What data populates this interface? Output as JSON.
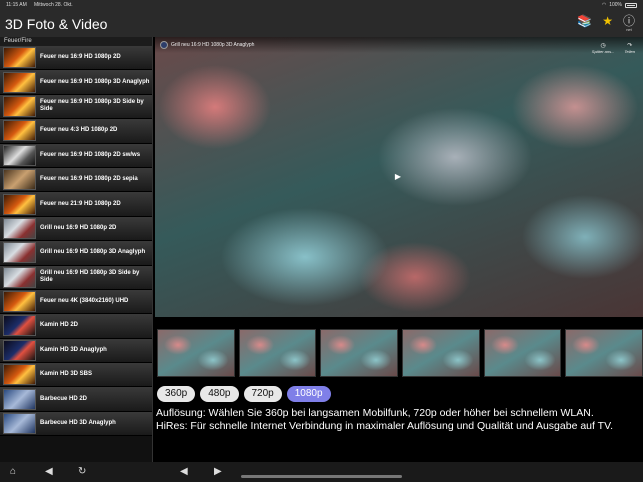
{
  "status": {
    "time": "11:15 AM",
    "date": "Mittwoch 28. Okt.",
    "battery": "100%"
  },
  "app": {
    "title": "3D Foto & Video",
    "info_sub": "net"
  },
  "sidebar": {
    "section": "Feuer/Fire",
    "items": [
      {
        "label": "Feuer neu 16:9 HD 1080p 2D",
        "thumb": "fire"
      },
      {
        "label": "Feuer neu 16:9 HD 1080p 3D Anaglyph",
        "thumb": "fire"
      },
      {
        "label": "Feuer neu 16:9 HD 1080p 3D Side by Side",
        "thumb": "fire"
      },
      {
        "label": "Feuer neu 4:3 HD 1080p 2D",
        "thumb": "fire"
      },
      {
        "label": "Feuer neu 16:9 HD 1080p 2D sw/ws",
        "thumb": "grey"
      },
      {
        "label": "Feuer neu 16:9 HD 1080p 2D sepia",
        "thumb": "sepia"
      },
      {
        "label": "Feuer neu 21:9 HD 1080p 2D",
        "thumb": "fire"
      },
      {
        "label": "Grill neu 16:9 HD 1080p 2D",
        "thumb": "grill"
      },
      {
        "label": "Grill neu 16:9 HD 1080p 3D Anaglyph",
        "thumb": "grill"
      },
      {
        "label": "Grill neu 16:9 HD 1080p 3D Side by Side",
        "thumb": "grill"
      },
      {
        "label": "Feuer neu 4K (3840x2160) UHD",
        "thumb": "fire"
      },
      {
        "label": "Kamin HD 2D",
        "thumb": "kamin"
      },
      {
        "label": "Kamin HD 3D Anaglyph",
        "thumb": "kamin"
      },
      {
        "label": "Kamin HD 3D SBS",
        "thumb": "fire"
      },
      {
        "label": "Barbecue HD 2D",
        "thumb": "bbq"
      },
      {
        "label": "Barbecue HD 3D Anaglyph",
        "thumb": "bbq"
      }
    ]
  },
  "video": {
    "title": "Grill neu 16:9 HD 1080p 3D Anaglyph",
    "later_label": "Später ans...",
    "share_label": "Teilen"
  },
  "resolutions": {
    "options": [
      "360p",
      "480p",
      "720p",
      "1080p"
    ],
    "selected": "1080p"
  },
  "info": {
    "line1": "Auflösung: Wählen Sie 360p bei langsamen Mobilfunk, 720p oder höher bei schnellem WLAN.",
    "line2": "HiRes: Für schnelle Internet Verbindung in maximaler Auflösung und Qualität und Ausgabe auf TV."
  },
  "colors": {
    "accent": "#7f7fe8",
    "star": "#f2c200",
    "background": "#000000"
  },
  "icons": [
    "home-icon",
    "back-icon",
    "reload-icon",
    "prev-icon",
    "next-icon",
    "books-icon",
    "star-icon",
    "info-icon",
    "play-icon"
  ]
}
